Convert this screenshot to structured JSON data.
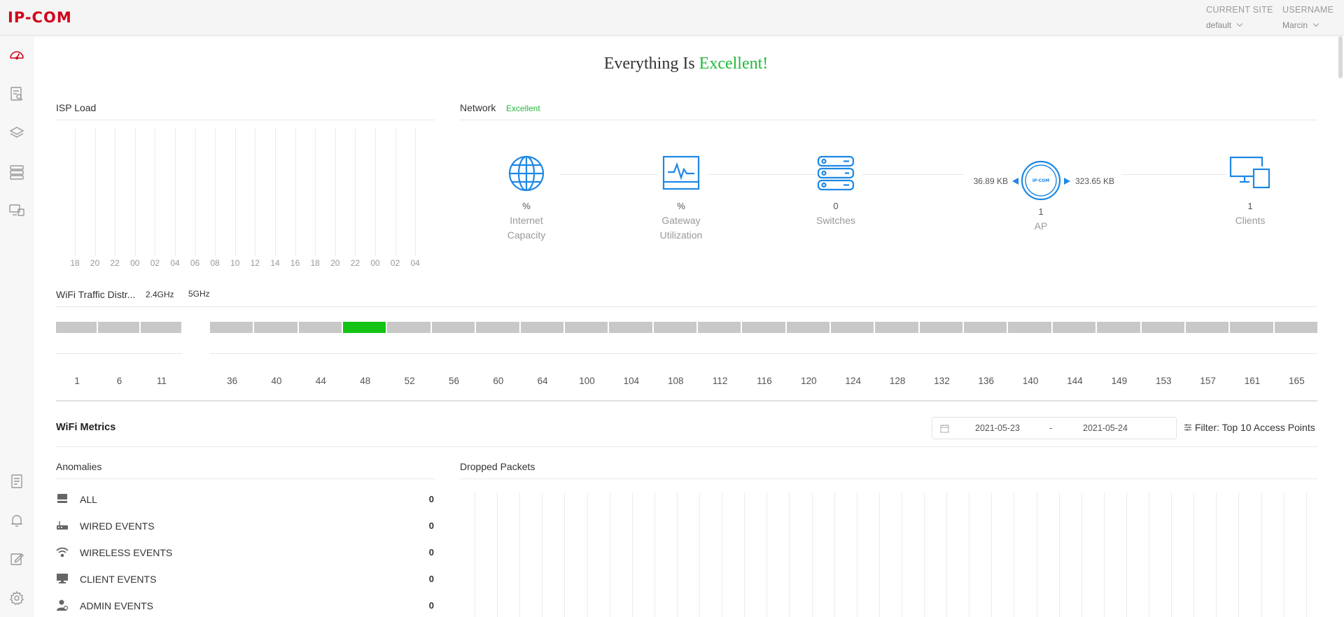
{
  "app": {
    "logo_text": "IP-COM",
    "brand_color": "#d0021b"
  },
  "header": {
    "current_site": {
      "label": "CURRENT SITE",
      "value": "default"
    },
    "username": {
      "label": "USERNAME",
      "value": "Marcin"
    }
  },
  "sidebar": {
    "items": [
      {
        "icon": "dashboard-icon",
        "active": true
      },
      {
        "icon": "statistics-icon",
        "active": false
      },
      {
        "icon": "layers-icon",
        "active": false
      },
      {
        "icon": "devices-icon",
        "active": false
      },
      {
        "icon": "clients-icon",
        "active": false
      },
      {
        "icon": "log-icon",
        "active": false
      },
      {
        "icon": "alarm-bell-icon",
        "active": false
      },
      {
        "icon": "edit-icon",
        "active": false
      },
      {
        "icon": "settings-gear-icon",
        "active": false
      }
    ]
  },
  "status": {
    "prefix": "Everything Is",
    "value": "Excellent!",
    "color": "#1fb93b"
  },
  "isp_load": {
    "title": "ISP Load",
    "ticks": [
      "18",
      "20",
      "22",
      "00",
      "02",
      "04",
      "06",
      "08",
      "10",
      "12",
      "14",
      "16",
      "18",
      "20",
      "22",
      "00",
      "02",
      "04"
    ]
  },
  "network": {
    "title": "Network",
    "status": "Excellent",
    "internet": {
      "value": "%",
      "label_1": "Internet",
      "label_2": "Capacity",
      "icon": "globe-icon"
    },
    "gateway": {
      "value": "%",
      "label_1": "Gateway",
      "label_2": "Utilization",
      "icon": "gateway-pulse-icon"
    },
    "switches": {
      "value": "0",
      "label": "Switches",
      "icon": "switch-stack-icon"
    },
    "ap": {
      "value": "1",
      "label": "AP",
      "badge": "IP-COM",
      "icon": "access-point-icon",
      "upload": "36.89 KB",
      "download": "323.65 KB"
    },
    "clients": {
      "value": "1",
      "label": "Clients",
      "icon": "client-devices-icon"
    },
    "accent_color": "#1e88e5"
  },
  "wifi_traffic": {
    "title": "WiFi Traffic Distr...",
    "band_24_tab": "2.4GHz",
    "band_5_tab": "5GHz",
    "channels_24": [
      "1",
      "6",
      "11"
    ],
    "channels_5": [
      "36",
      "40",
      "44",
      "48",
      "52",
      "56",
      "60",
      "64",
      "100",
      "104",
      "108",
      "112",
      "116",
      "120",
      "124",
      "128",
      "132",
      "136",
      "140",
      "144",
      "149",
      "153",
      "157",
      "161",
      "165"
    ],
    "active_channel": "48",
    "active_color": "#14c314",
    "idle_color": "#c8c8c8"
  },
  "wifi_metrics": {
    "title": "WiFi Metrics",
    "date_from": "2021-05-23",
    "date_sep": "-",
    "date_to": "2021-05-24",
    "filter_label": "Filter: Top 10 Access Points"
  },
  "anomalies": {
    "title": "Anomalies",
    "rows": [
      {
        "label": "ALL",
        "count": "0",
        "icon": "all-events-icon"
      },
      {
        "label": "WIRED EVENTS",
        "count": "0",
        "icon": "wired-router-icon"
      },
      {
        "label": "WIRELESS EVENTS",
        "count": "0",
        "icon": "wifi-icon"
      },
      {
        "label": "CLIENT EVENTS",
        "count": "0",
        "icon": "monitor-icon"
      },
      {
        "label": "ADMIN EVENTS",
        "count": "0",
        "icon": "admin-user-icon"
      }
    ]
  },
  "dropped_packets": {
    "title": "Dropped Packets"
  }
}
